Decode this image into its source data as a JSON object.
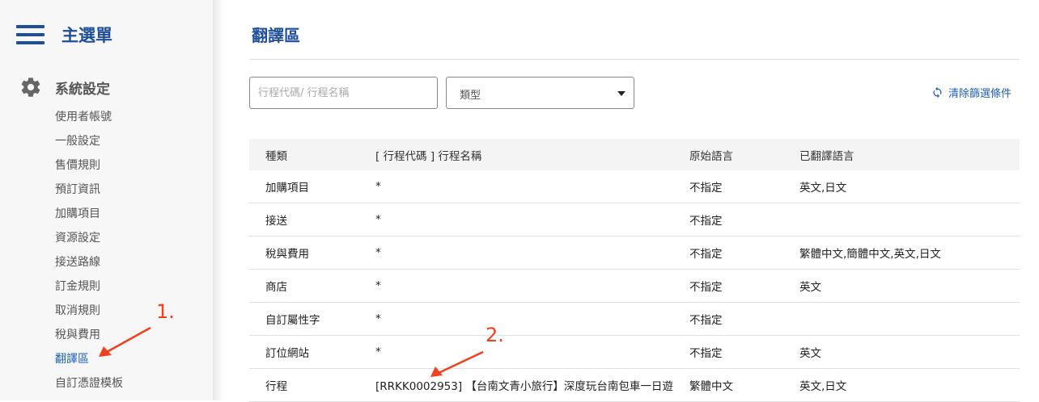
{
  "sidebar": {
    "menu_title": "主選單",
    "group_title": "系統設定",
    "items": [
      {
        "label": "使用者帳號",
        "active": false
      },
      {
        "label": "一般設定",
        "active": false
      },
      {
        "label": "售價規則",
        "active": false
      },
      {
        "label": "預訂資訊",
        "active": false
      },
      {
        "label": "加購項目",
        "active": false
      },
      {
        "label": "資源設定",
        "active": false
      },
      {
        "label": "接送路線",
        "active": false
      },
      {
        "label": "訂金規則",
        "active": false
      },
      {
        "label": "取消規則",
        "active": false
      },
      {
        "label": "稅與費用",
        "active": false
      },
      {
        "label": "翻譯區",
        "active": true
      },
      {
        "label": "自訂憑證模板",
        "active": false
      }
    ]
  },
  "main": {
    "title": "翻譯區",
    "search_placeholder": "行程代碼/ 行程名稱",
    "type_select": "類型",
    "clear_filters": "清除篩選條件"
  },
  "table": {
    "headers": [
      "種類",
      "[ 行程代碼 ] 行程名稱",
      "原始語言",
      "已翻譯語言"
    ],
    "rows": [
      [
        "加購項目",
        "*",
        "不指定",
        "英文,日文"
      ],
      [
        "接送",
        "*",
        "不指定",
        ""
      ],
      [
        "稅與費用",
        "*",
        "不指定",
        "繁體中文,簡體中文,英文,日文"
      ],
      [
        "商店",
        "*",
        "不指定",
        "英文"
      ],
      [
        "自訂屬性字",
        "*",
        "不指定",
        ""
      ],
      [
        "訂位網站",
        "*",
        "不指定",
        "英文"
      ],
      [
        "行程",
        "[RRKK0002953] 【台南文青小旅行】深度玩台南包車一日遊",
        "繁體中文",
        "英文,日文"
      ]
    ]
  },
  "annotations": {
    "label_1": "1.",
    "label_2": "2."
  },
  "colors": {
    "brand": "#1e4e9c",
    "link": "#1e5fb8",
    "annotation": "#f04020"
  }
}
